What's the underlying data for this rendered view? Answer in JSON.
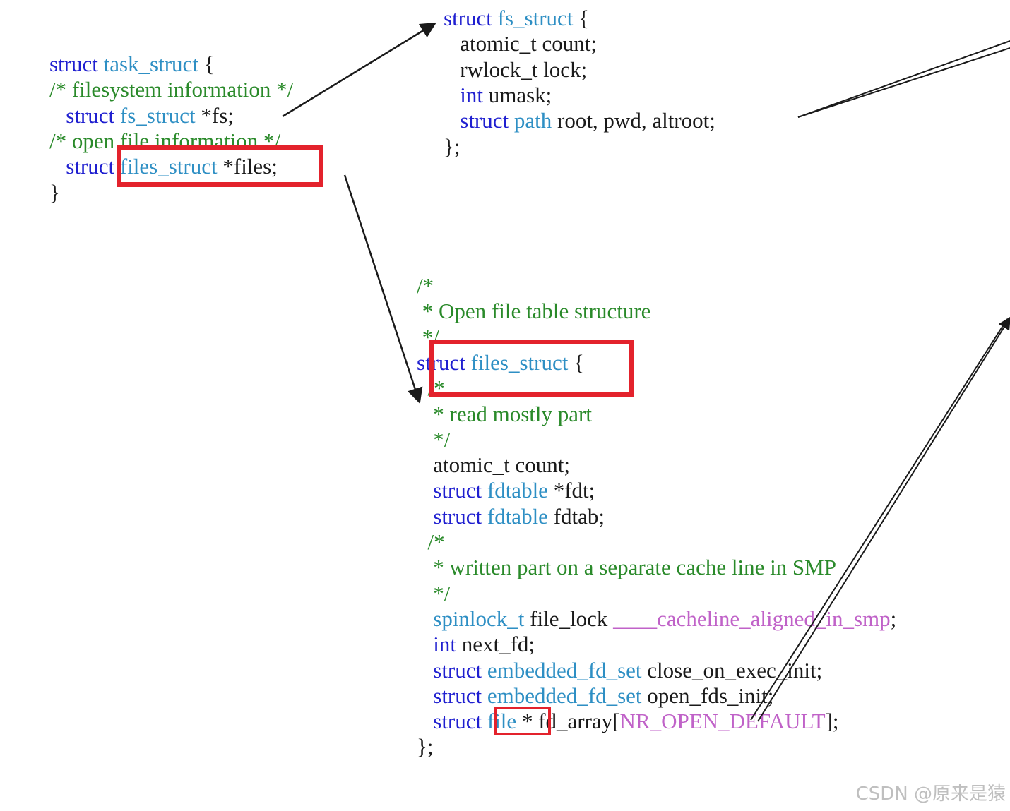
{
  "code_blocks": {
    "task_struct": {
      "lines": [
        [
          {
            "t": "struct ",
            "c": "kw"
          },
          {
            "t": "task_struct",
            "c": "ty"
          },
          {
            "t": " {",
            "c": "pl"
          }
        ],
        [
          {
            "t": "/* filesystem information */",
            "c": "cm"
          }
        ],
        [
          {
            "t": "   struct ",
            "c": "kw"
          },
          {
            "t": "fs_struct",
            "c": "ty"
          },
          {
            "t": " *fs;",
            "c": "pl"
          }
        ],
        [
          {
            "t": "/* open file information */",
            "c": "cm"
          }
        ],
        [
          {
            "t": "   struct ",
            "c": "kw"
          },
          {
            "t": "files_struct",
            "c": "ty"
          },
          {
            "t": " *files;",
            "c": "pl"
          }
        ],
        [
          {
            "t": "}",
            "c": "pl"
          }
        ]
      ]
    },
    "fs_struct": {
      "lines": [
        [
          {
            "t": "struct ",
            "c": "kw"
          },
          {
            "t": "fs_struct",
            "c": "ty"
          },
          {
            "t": " {",
            "c": "pl"
          }
        ],
        [
          {
            "t": "   atomic_t count;",
            "c": "pl"
          }
        ],
        [
          {
            "t": "   rwlock_t lock;",
            "c": "pl"
          }
        ],
        [
          {
            "t": "   int ",
            "c": "kw"
          },
          {
            "t": "umask;",
            "c": "pl"
          }
        ],
        [
          {
            "t": "   struct ",
            "c": "kw"
          },
          {
            "t": "path",
            "c": "ty"
          },
          {
            "t": " root, pwd, altroot;",
            "c": "pl"
          }
        ],
        [
          {
            "t": "};",
            "c": "pl"
          }
        ]
      ]
    },
    "files_struct": {
      "lines": [
        [
          {
            "t": "/*",
            "c": "cm"
          }
        ],
        [
          {
            "t": " * Open file table structure",
            "c": "cm"
          }
        ],
        [
          {
            "t": " */",
            "c": "cm"
          }
        ],
        [
          {
            "t": "struct ",
            "c": "kw"
          },
          {
            "t": "files_struct",
            "c": "ty"
          },
          {
            "t": " {",
            "c": "pl"
          }
        ],
        [
          {
            "t": "  /*",
            "c": "cm"
          }
        ],
        [
          {
            "t": "   * read mostly part",
            "c": "cm"
          }
        ],
        [
          {
            "t": "   */",
            "c": "cm"
          }
        ],
        [
          {
            "t": "   atomic_t count;",
            "c": "pl"
          }
        ],
        [
          {
            "t": "   struct ",
            "c": "kw"
          },
          {
            "t": "fdtable",
            "c": "ty"
          },
          {
            "t": " *fdt;",
            "c": "pl"
          }
        ],
        [
          {
            "t": "   struct ",
            "c": "kw"
          },
          {
            "t": "fdtable",
            "c": "ty"
          },
          {
            "t": " fdtab;",
            "c": "pl"
          }
        ],
        [
          {
            "t": "  /*",
            "c": "cm"
          }
        ],
        [
          {
            "t": "   * written part on a separate cache line in SMP",
            "c": "cm"
          }
        ],
        [
          {
            "t": "   */",
            "c": "cm"
          }
        ],
        [
          {
            "t": "   spinlock_t",
            "c": "ty"
          },
          {
            "t": " file_lock ",
            "c": "pl"
          },
          {
            "t": "____cacheline_aligned_in_smp",
            "c": "mc"
          },
          {
            "t": ";",
            "c": "pl"
          }
        ],
        [
          {
            "t": "   int ",
            "c": "kw"
          },
          {
            "t": "next_fd;",
            "c": "pl"
          }
        ],
        [
          {
            "t": "   struct ",
            "c": "kw"
          },
          {
            "t": "embedded_fd_set",
            "c": "ty"
          },
          {
            "t": " close_on_exec_init;",
            "c": "pl"
          }
        ],
        [
          {
            "t": "   struct ",
            "c": "kw"
          },
          {
            "t": "embedded_fd_set",
            "c": "ty"
          },
          {
            "t": " open_fds_init;",
            "c": "pl"
          }
        ],
        [
          {
            "t": "   struct ",
            "c": "kw"
          },
          {
            "t": "file",
            "c": "ty"
          },
          {
            "t": " * fd_array[",
            "c": "pl"
          },
          {
            "t": "NR_OPEN_DEFAULT",
            "c": "mc"
          },
          {
            "t": "];",
            "c": "pl"
          }
        ],
        [
          {
            "t": "};",
            "c": "pl"
          }
        ]
      ]
    }
  },
  "watermark": "CSDN @原来是猿",
  "colors": {
    "keyword": "#1f1fd0",
    "type": "#2e8fc4",
    "comment": "#2a8a2a",
    "macro": "#c062c8",
    "highlight_box": "#e3222c",
    "arrow": "#1a1a1a"
  }
}
